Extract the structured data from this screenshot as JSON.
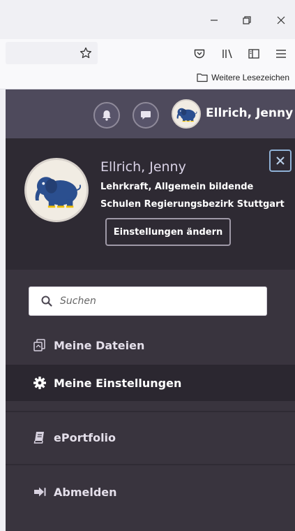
{
  "browser": {
    "bookmarks_folder_label": "Weitere Lesezeichen"
  },
  "header": {
    "user_name": "Ellrich, Jenny"
  },
  "profile": {
    "name": "Ellrich, Jenny",
    "role": "Lehrkraft, Allgemein bildende Schulen Regierungsbezirk Stuttgart",
    "settings_button_label": "Einstellungen ändern"
  },
  "search": {
    "placeholder": "Suchen"
  },
  "nav": {
    "items": [
      {
        "label": "Meine Dateien",
        "icon": "files-icon",
        "active": false
      },
      {
        "label": "Meine Einstellungen",
        "icon": "gear-icon",
        "active": true
      },
      {
        "label": "ePortfolio",
        "icon": "book-icon",
        "active": false
      },
      {
        "label": "Abmelden",
        "icon": "logout-icon",
        "active": false
      }
    ]
  },
  "colors": {
    "header_bg": "#4e4a5c",
    "panel_bg": "#39343e",
    "profile_bg": "#2e2a33",
    "close_accent": "#8fb1d6"
  }
}
